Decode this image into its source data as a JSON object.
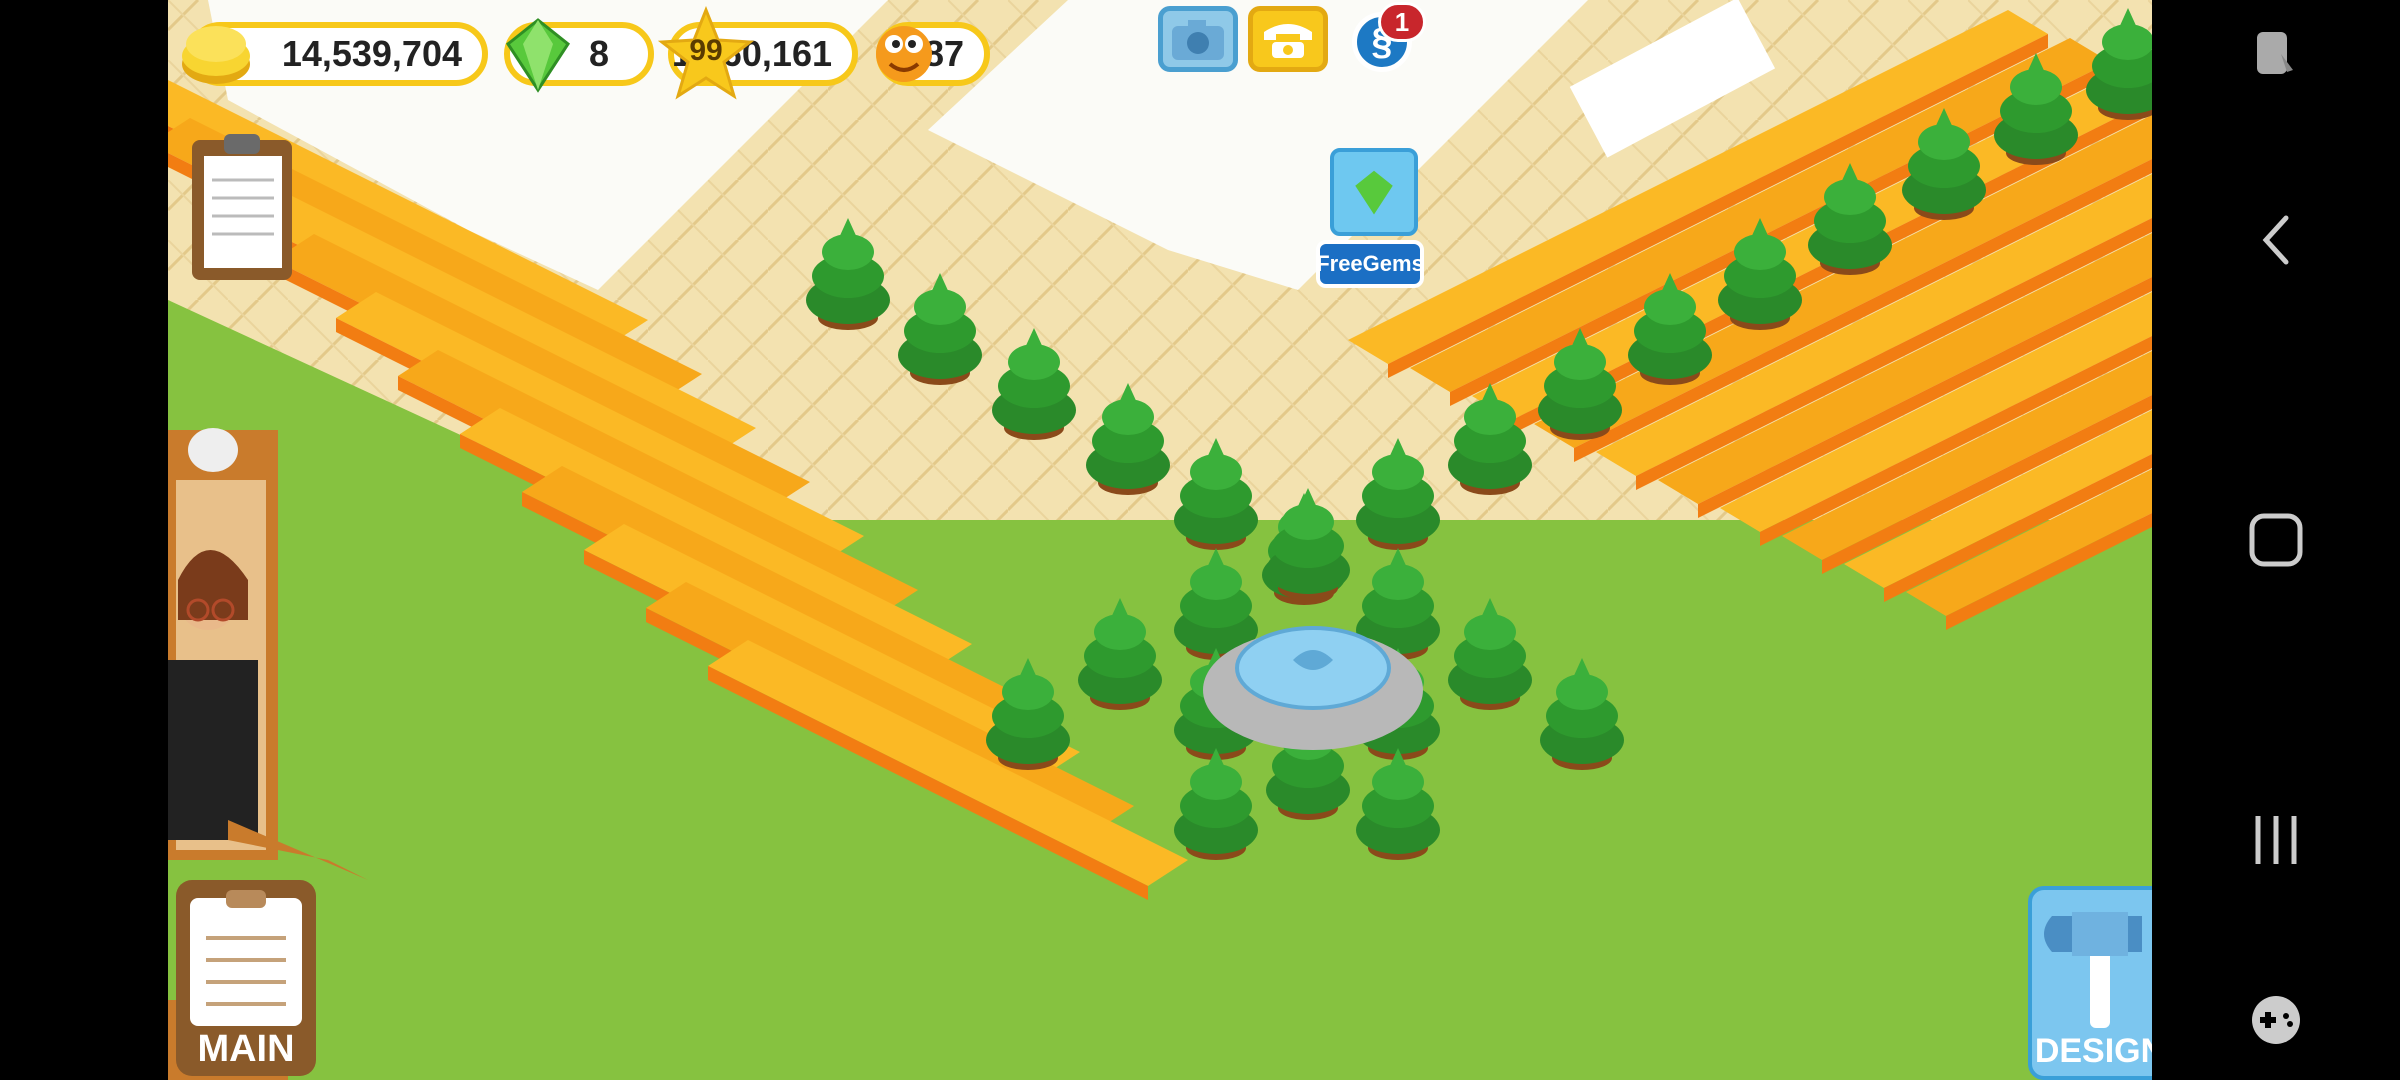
{
  "hud": {
    "coins": "14,539,704",
    "gems": "8",
    "level": "99",
    "xp": "1,860,161",
    "friends": "87",
    "notification_count": "1"
  },
  "buttons": {
    "free_gems_label": "FreeGems",
    "main_label": "MAIN",
    "design_label": "DESIGN"
  },
  "icons": {
    "coin": "coin-icon",
    "gem": "gem-icon",
    "star": "star-icon",
    "friend": "friend-face-icon",
    "camera": "camera-icon",
    "phone": "phone-icon",
    "social": "social-icon",
    "clipboard": "clipboard-icon",
    "hammer": "hammer-icon"
  },
  "colors": {
    "gold": "#f7c81a",
    "grass": "#86c240",
    "table_orange": "#f7a81a",
    "table_dark": "#f27d12",
    "tree_green": "#2e9a2e",
    "fountain_blue": "#8fd0f2"
  }
}
